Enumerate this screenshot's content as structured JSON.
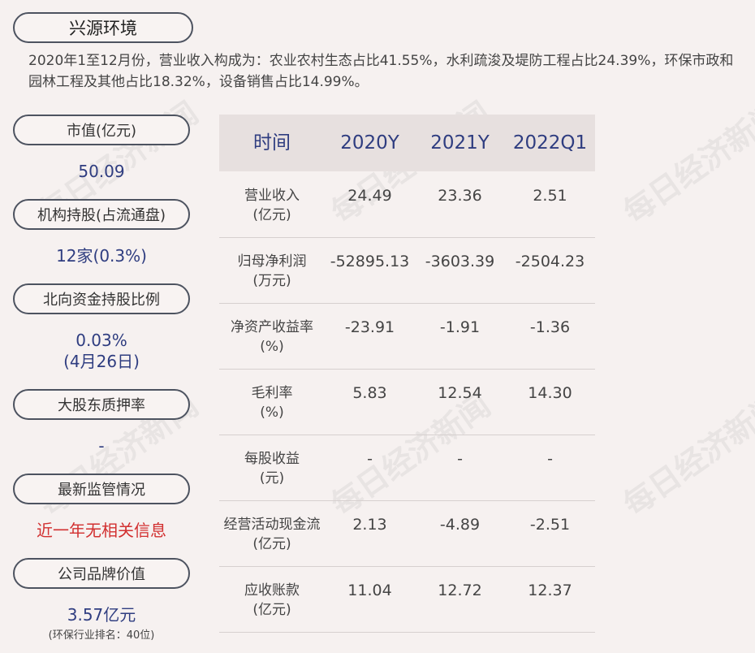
{
  "company": "兴源环境",
  "summary": "2020年1至12月份，营业收入构成为：农业农村生态占比41.55%，水利疏浚及堤防工程占比24.39%，环保市政和园林工程及其他占比18.32%，设备销售占比14.99%。",
  "left": {
    "market_cap_label": "市值(亿元)",
    "market_cap_value": "50.09",
    "institution_label": "机构持股(占流通盘)",
    "institution_value": "12家(0.3%)",
    "northbound_label": "北向资金持股比例",
    "northbound_value": "0.03%",
    "northbound_date": "(4月26日)",
    "pledge_label": "大股东质押率",
    "pledge_value": "-",
    "regulatory_label": "最新监管情况",
    "regulatory_value": "近一年无相关信息",
    "brand_label": "公司品牌价值",
    "brand_value": "3.57亿元",
    "brand_rank": "(环保行业排名：40位)"
  },
  "table": {
    "headers": [
      "时间",
      "2020Y",
      "2021Y",
      "2022Q1"
    ],
    "rows": [
      {
        "label": "营业收入",
        "unit": "(亿元)",
        "values": [
          "24.49",
          "23.36",
          "2.51"
        ]
      },
      {
        "label": "归母净利润",
        "unit": "(万元)",
        "values": [
          "-52895.13",
          "-3603.39",
          "-2504.23"
        ]
      },
      {
        "label": "净资产收益率",
        "unit": "(%)",
        "values": [
          "-23.91",
          "-1.91",
          "-1.36"
        ]
      },
      {
        "label": "毛利率",
        "unit": "(%)",
        "values": [
          "5.83",
          "12.54",
          "14.30"
        ]
      },
      {
        "label": "每股收益",
        "unit": "(元)",
        "values": [
          "-",
          "-",
          "-"
        ]
      },
      {
        "label": "经营活动现金流",
        "unit": "(亿元)",
        "values": [
          "2.13",
          "-4.89",
          "-2.51"
        ]
      },
      {
        "label": "应收账款",
        "unit": "(亿元)",
        "values": [
          "11.04",
          "12.72",
          "12.37"
        ]
      }
    ]
  },
  "watermark": "每日经济新闻",
  "colors": {
    "accent": "#2f3d80",
    "alert": "#d23030",
    "background": "#f6f1f0"
  }
}
